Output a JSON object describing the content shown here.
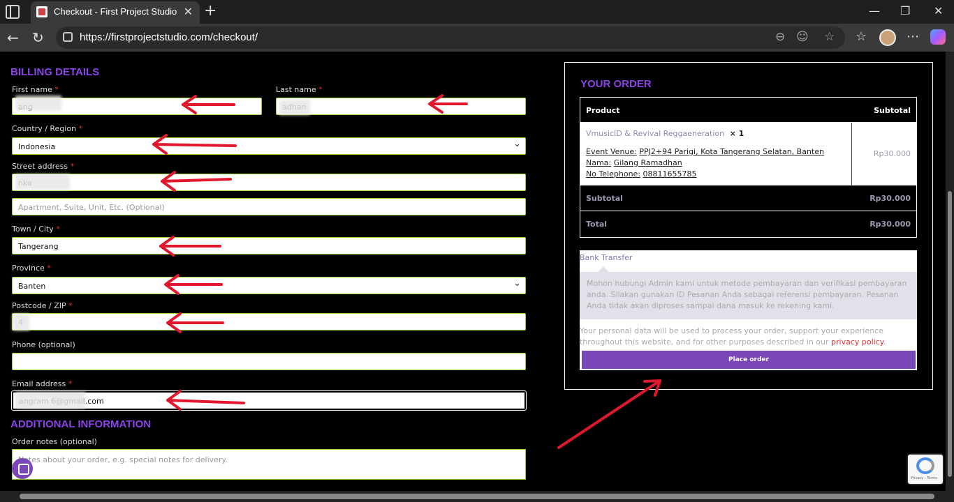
{
  "browser": {
    "tab_title": "Checkout - First Project Studio",
    "url": "https://firstprojectstudio.com/checkout/",
    "new_tab": "+",
    "close_tab": "✕",
    "minimize": "—",
    "restore": "❐",
    "close_window": "✕"
  },
  "billing": {
    "heading": "BILLING DETAILS",
    "first_name_label": "First name",
    "first_name_value": "    ang",
    "last_name_label": "Last name",
    "last_name_value": "      adhan",
    "country_label": "Country / Region",
    "country_value": "Indonesia",
    "street_label": "Street address",
    "street_value": "              nka",
    "apartment_placeholder": "Apartment, Suite, Unit, Etc. (Optional)",
    "town_label": "Town / City",
    "town_value": "Tangerang",
    "province_label": "Province",
    "province_value": "Banten",
    "postcode_label": "Postcode / ZIP",
    "postcode_value": "    4",
    "phone_label": "Phone (optional)",
    "phone_value": "",
    "email_label": "Email address",
    "email_value": "   angram      6@gmail.com",
    "required_mark": "*"
  },
  "additional": {
    "heading": "ADDITIONAL INFORMATION",
    "notes_label": "Order notes (optional)",
    "notes_placeholder": "Notes about your order, e.g. special notes for delivery."
  },
  "order": {
    "heading": "YOUR ORDER",
    "col_product": "Product",
    "col_subtotal": "Subtotal",
    "item_name": "VmusicID & Revival Reggaeneration",
    "item_qty": "× 1",
    "venue_label": "Event Venue:",
    "venue_value": "PPJ2+94 Parigi, Kota Tangerang Selatan, Banten",
    "nama_label": "Nama:",
    "nama_value": "Gilang Ramadhan",
    "phone_label": "No Telephone:",
    "phone_value": "08811655785",
    "item_price": "Rp30.000",
    "subtotal_label": "Subtotal",
    "subtotal_value": "Rp30.000",
    "total_label": "Total",
    "total_value": "Rp30.000"
  },
  "payment": {
    "method": "Bank Transfer",
    "description": "Mohon hubungi Admin kami untuk metode pembayaran dan verifikasi pembayaran anda. Silakan gunakan ID Pesanan Anda sebagai referensi pembayaran. Pesanan Anda tidak akan diproses sampai dana masuk ke rekening kami.",
    "privacy_text": "Your personal data will be used to process your order, support your experience throughout this website, and for other purposes described in our ",
    "privacy_link": "privacy policy",
    "privacy_end": ".",
    "place_order": "Place order"
  },
  "recaptcha": {
    "text": "Privacy - Terms"
  },
  "colors": {
    "accent": "#8a44e6",
    "button": "#7a47b8",
    "arrow": "#e0182d",
    "field_border": "#9acd32"
  }
}
